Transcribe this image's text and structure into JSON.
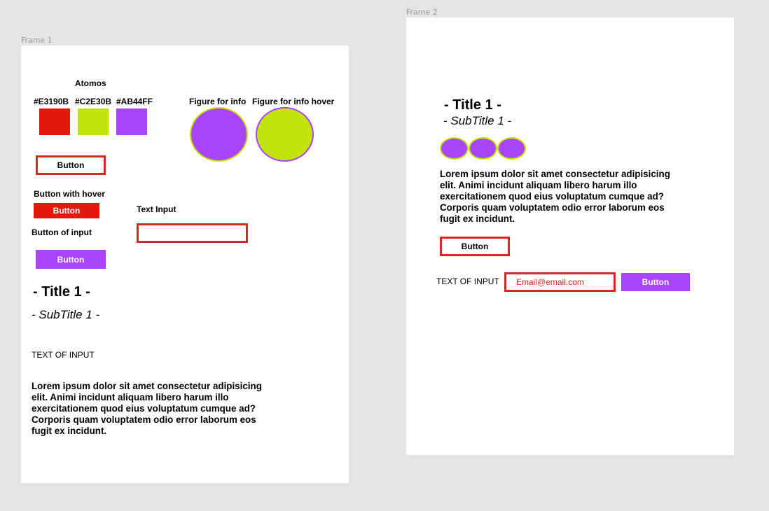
{
  "canvas": {
    "frame1_label": "Frame 1",
    "frame2_label": "Frame 2"
  },
  "frame1": {
    "heading": "Atomos",
    "swatches": [
      {
        "label": "#E3190B",
        "color": "#E3190B"
      },
      {
        "label": "#C2E30B",
        "color": "#C2E30B"
      },
      {
        "label": "#AB44FF",
        "color": "#AB44FF"
      }
    ],
    "figure_info_label": "Figure for info",
    "figure_info_hover_label": "Figure for info hover",
    "button_label": "Button",
    "button_hover_caption": "Button with hover",
    "button_hover_label": "Button",
    "text_input_label": "Text Input",
    "button_of_input_caption": "Button of input",
    "button_of_input_label": "Button",
    "title": "- Title 1 -",
    "subtitle": "- SubTitle 1 -",
    "text_of_input": "TEXT OF INPUT",
    "lorem": "Lorem ipsum dolor sit amet consectetur adipisicing elit. Animi incidunt aliquam libero harum illo exercitationem quod eius voluptatum cumque ad? Corporis quam voluptatem odio error laborum eos fugit ex incidunt."
  },
  "frame2": {
    "title": "- Title 1 -",
    "subtitle": "- SubTitle 1 -",
    "lorem": "Lorem ipsum dolor sit amet consectetur adipisicing elit. Animi incidunt aliquam libero harum illo exercitationem quod eius voluptatum cumque ad? Corporis quam voluptatem odio error laborum eos fugit ex incidunt.",
    "button_label": "Button",
    "text_of_input": "TEXT OF INPUT",
    "email_value": "Email@email.com",
    "submit_label": "Button"
  },
  "colors": {
    "red": "#E3190B",
    "lime": "#C2E30B",
    "purple": "#AB44FF",
    "border_red": "#D42A1F"
  }
}
